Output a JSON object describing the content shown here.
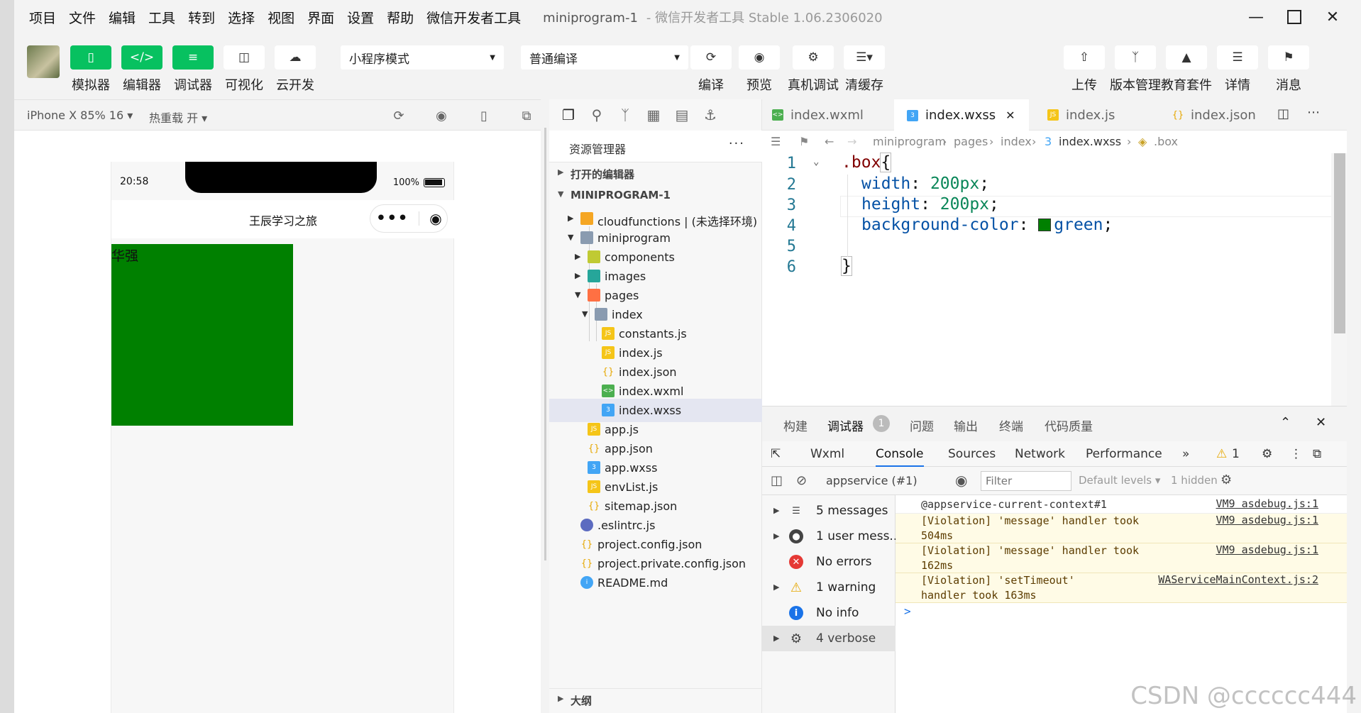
{
  "menubar": {
    "items": [
      "项目",
      "文件",
      "编辑",
      "工具",
      "转到",
      "选择",
      "视图",
      "界面",
      "设置",
      "帮助",
      "微信开发者工具"
    ],
    "title": "miniprogram-1",
    "title_sub": "- 微信开发者工具 Stable 1.06.2306020"
  },
  "toolbar": {
    "simulator": "模拟器",
    "editor": "编辑器",
    "debugger": "调试器",
    "visual": "可视化",
    "cloud": "云开发",
    "mode_select": "小程序模式",
    "compile_select": "普通编译",
    "compile": "编译",
    "preview": "预览",
    "remote_debug": "真机调试",
    "clear_cache": "清缓存",
    "upload": "上传",
    "version": "版本管理",
    "edu": "教育套件",
    "details": "详情",
    "messages": "消息"
  },
  "simulator": {
    "device": "iPhone X 85% 16",
    "hot_reload": "热重载 开",
    "time": "20:58",
    "battery": "100%",
    "nav_title": "王辰学习之旅",
    "box_text": "华强",
    "box_color": "#008000"
  },
  "explorer": {
    "title": "资源管理器",
    "more": "···",
    "open_editors": "打开的编辑器",
    "project": "MINIPROGRAM-1",
    "outline": "大纲",
    "tree": [
      {
        "name": "cloudfunctions | (未选择环境)"
      },
      {
        "name": "miniprogram"
      },
      {
        "name": "components"
      },
      {
        "name": "images"
      },
      {
        "name": "pages"
      },
      {
        "name": "index"
      },
      {
        "name": "constants.js"
      },
      {
        "name": "index.js"
      },
      {
        "name": "index.json"
      },
      {
        "name": "index.wxml"
      },
      {
        "name": "index.wxss"
      },
      {
        "name": "app.js"
      },
      {
        "name": "app.json"
      },
      {
        "name": "app.wxss"
      },
      {
        "name": "envList.js"
      },
      {
        "name": "sitemap.json"
      },
      {
        "name": ".eslintrc.js"
      },
      {
        "name": "project.config.json"
      },
      {
        "name": "project.private.config.json"
      },
      {
        "name": "README.md"
      }
    ]
  },
  "editor": {
    "tabs": [
      "index.wxml",
      "index.wxss",
      "index.js",
      "index.json"
    ],
    "breadcrumb": [
      "miniprogram",
      "pages",
      "index",
      "index.wxss",
      ".box"
    ],
    "line_numbers": [
      "1",
      "2",
      "3",
      "4",
      "5",
      "6"
    ],
    "code": {
      "l1_sel": ".box",
      "l1_brace": "{",
      "l2_prop": "width",
      "l2_val": "200px",
      "l3_prop": "height",
      "l3_val": "200px",
      "l4_prop": "background-color",
      "l4_val": "green",
      "l6_brace": "}"
    },
    "swatch_color": "#008000"
  },
  "debugger": {
    "top_tabs": [
      "构建",
      "调试器",
      "问题",
      "输出",
      "终端",
      "代码质量"
    ],
    "badge": "1",
    "devtools_tabs": [
      "Wxml",
      "Console",
      "Sources",
      "Network",
      "Performance",
      "»"
    ],
    "warn_count": "1",
    "context": "appservice (#1)",
    "filter_placeholder": "Filter",
    "levels": "Default levels",
    "hidden": "1 hidden",
    "sidebar": [
      "5 messages",
      "1 user mess...",
      "No errors",
      "1 warning",
      "No info",
      "4 verbose"
    ],
    "logs": [
      {
        "msg": "@appservice-current-context#1",
        "src": "VM9 asdebug.js:1"
      },
      {
        "msg": "[Violation] 'message' handler took\n504ms",
        "src": "VM9 asdebug.js:1"
      },
      {
        "msg": "[Violation] 'message' handler took\n162ms",
        "src": "VM9 asdebug.js:1"
      },
      {
        "msg": "[Violation] 'setTimeout'\nhandler took 163ms",
        "src": "WAServiceMainContext.js:2"
      }
    ],
    "prompt": ">"
  },
  "watermark": "CSDN @cccccc444"
}
